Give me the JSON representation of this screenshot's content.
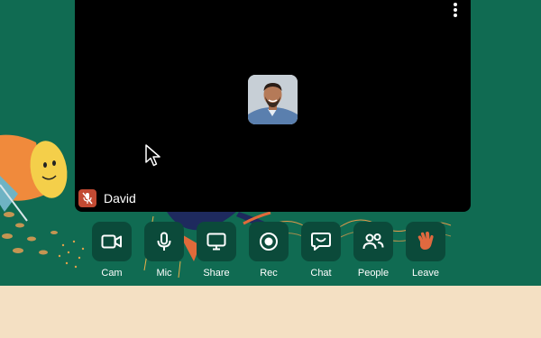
{
  "participant": {
    "name": "David"
  },
  "controls": [
    {
      "label": "Cam",
      "icon": "camera-icon"
    },
    {
      "label": "Mic",
      "icon": "microphone-icon"
    },
    {
      "label": "Share",
      "icon": "monitor-icon"
    },
    {
      "label": "Rec",
      "icon": "record-icon"
    },
    {
      "label": "Chat",
      "icon": "chat-icon"
    },
    {
      "label": "People",
      "icon": "people-icon"
    },
    {
      "label": "Leave",
      "icon": "wave-hand-icon"
    }
  ],
  "colors": {
    "background": "#106b52",
    "bottom_band": "#f4e0c3",
    "control_button": "#0b4a3a",
    "mic_off_badge": "#c24a33",
    "leave_icon": "#e0693f"
  }
}
